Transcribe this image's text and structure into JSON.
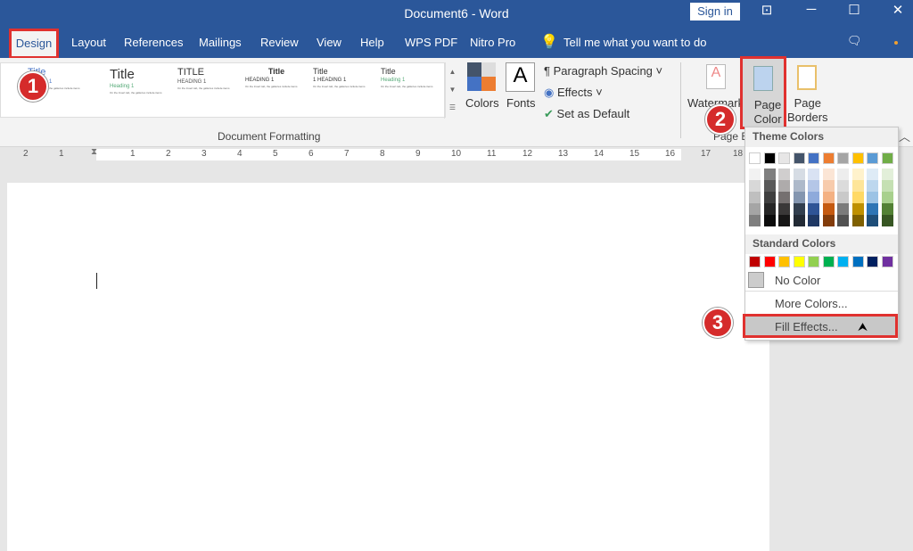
{
  "window": {
    "title": "Document6  -  Word",
    "sign_in": "Sign in"
  },
  "tabs": [
    "Design",
    "Layout",
    "References",
    "Mailings",
    "Review",
    "View",
    "Help",
    "WPS PDF",
    "Nitro Pro"
  ],
  "tell_me": "Tell me what you want to do",
  "gallery": [
    {
      "title": "Title",
      "heading": "Heading 1"
    },
    {
      "title": "Title",
      "heading": "Heading 1"
    },
    {
      "title": "TITLE",
      "heading": "HEADING 1"
    },
    {
      "title": "Title",
      "heading": "HEADING 1"
    },
    {
      "title": "Title",
      "heading": "1   HEADING 1"
    },
    {
      "title": "Title",
      "heading": "Heading 1"
    }
  ],
  "ribbon": {
    "group_document_formatting": "Document Formatting",
    "colors": "Colors",
    "fonts": "Fonts",
    "paragraph_spacing": "Paragraph Spacing",
    "effects": "Effects",
    "set_as_default": "Set as Default",
    "watermark": "Watermark",
    "page_color": [
      "Page",
      "Color"
    ],
    "page_borders": [
      "Page",
      "Borders"
    ],
    "group_page_bg": "Page B"
  },
  "ruler": [
    "2",
    "1",
    "1",
    "2",
    "3",
    "4",
    "5",
    "6",
    "7",
    "8",
    "9",
    "10",
    "11",
    "12",
    "13",
    "14",
    "15",
    "16",
    "17",
    "18"
  ],
  "steps": [
    "1",
    "2",
    "3"
  ],
  "menu": {
    "theme_header": "Theme Colors",
    "theme": [
      "#ffffff",
      "#000000",
      "#e7e6e6",
      "#44546a",
      "#4472c4",
      "#ed7d31",
      "#a5a5a5",
      "#ffc000",
      "#5b9bd5",
      "#70ad47"
    ],
    "shades": [
      [
        "#f2f2f2",
        "#7f7f7f",
        "#d0cece",
        "#d6dce4",
        "#d9e2f3",
        "#fbe5d5",
        "#ededed",
        "#fff2cc",
        "#deebf6",
        "#e2efd9"
      ],
      [
        "#d8d8d8",
        "#595959",
        "#aeabab",
        "#adb9ca",
        "#b4c6e7",
        "#f7cbac",
        "#dbdbdb",
        "#fee599",
        "#bdd7ee",
        "#c5e0b3"
      ],
      [
        "#bfbfbf",
        "#3f3f3f",
        "#757070",
        "#8496b0",
        "#8eaadb",
        "#f4b183",
        "#c9c9c9",
        "#ffd965",
        "#9cc3e5",
        "#a8d08d"
      ],
      [
        "#a5a5a5",
        "#262626",
        "#3a3838",
        "#323f4f",
        "#2f5496",
        "#c55a11",
        "#7b7b7b",
        "#bf9000",
        "#2e75b5",
        "#538135"
      ],
      [
        "#7f7f7f",
        "#0c0c0c",
        "#171616",
        "#222a35",
        "#1f3864",
        "#833c0b",
        "#525252",
        "#7f6000",
        "#1e4e79",
        "#375623"
      ]
    ],
    "standard_header": "Standard Colors",
    "standard": [
      "#c00000",
      "#ff0000",
      "#ffc000",
      "#ffff00",
      "#92d050",
      "#00b050",
      "#00b0f0",
      "#0070c0",
      "#002060",
      "#7030a0"
    ],
    "no_color": "No Color",
    "more_colors": "More Colors...",
    "fill_effects": "Fill Effects..."
  }
}
